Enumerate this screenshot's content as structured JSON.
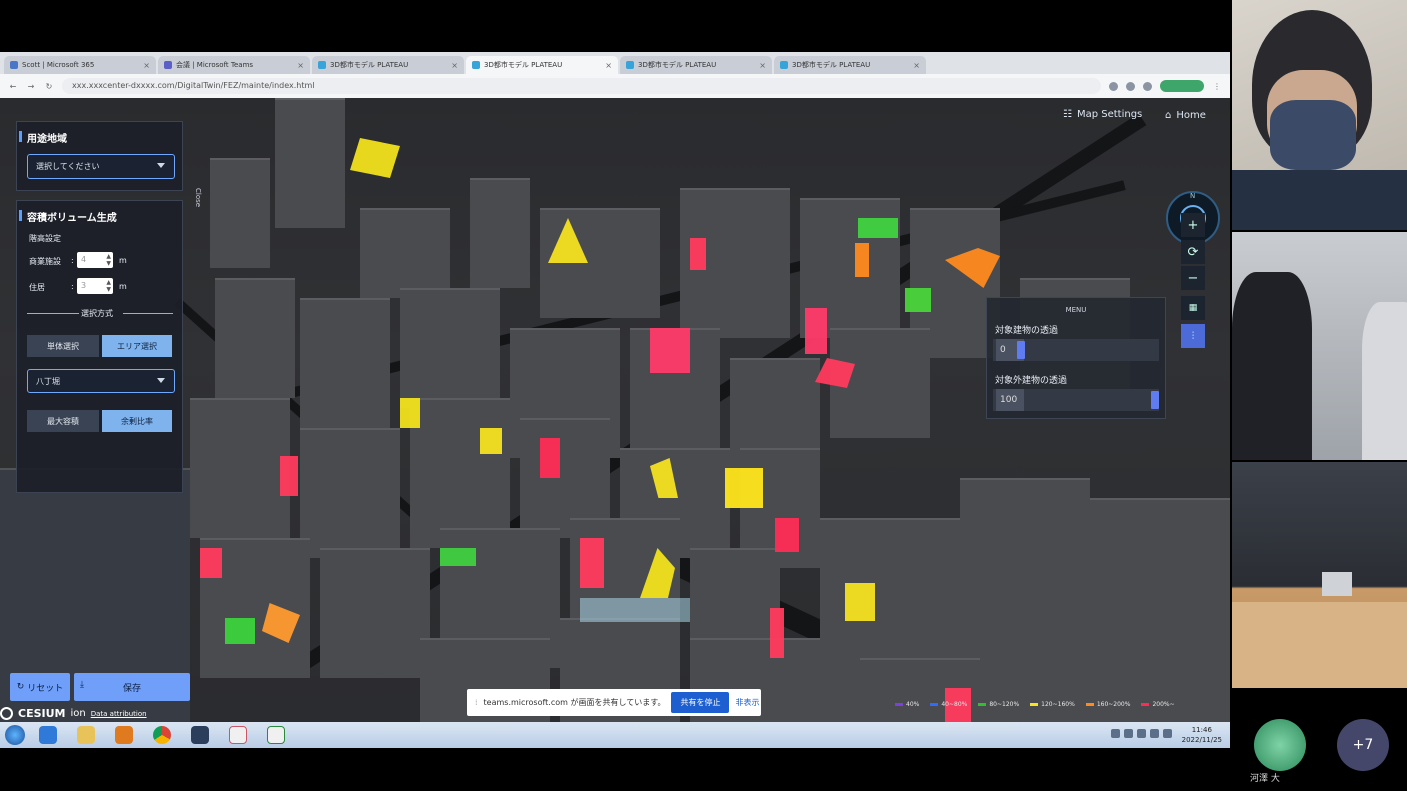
{
  "browser": {
    "tabs": [
      {
        "label": "Scott | Microsoft 365"
      },
      {
        "label": "会議 | Microsoft Teams"
      },
      {
        "label": "3D都市モデル PLATEAU"
      },
      {
        "label": "3D都市モデル PLATEAU"
      },
      {
        "label": "3D都市モデル PLATEAU"
      },
      {
        "label": "3D都市モデル PLATEAU"
      }
    ],
    "url": "xxx.xxxcenter-dxxxx.com/DigitalTwin/FEZ/mainte/index.html"
  },
  "left_panel": {
    "zoning": {
      "title": "用途地域",
      "select_value": "選択してください"
    },
    "volume": {
      "title": "容積ボリューム生成",
      "floor_heading": "階高設定",
      "commercial_label": "商業施設",
      "commercial_value": "4",
      "residential_label": "住居",
      "residential_value": "3",
      "unit": "m",
      "colon": ":",
      "selection_heading": "選択方式",
      "single_select": "単体選択",
      "area_select": "エリア選択",
      "area_value": "八丁堀",
      "max_volume": "最大容積",
      "surplus_ratio": "余剰比率"
    },
    "reset_label": "リセット",
    "save_label": "保存",
    "close_label": "Close"
  },
  "top_controls": {
    "map_settings": "Map Settings",
    "home": "Home",
    "compass_n": "N"
  },
  "menu_panel": {
    "title": "MENU",
    "target_label": "対象建物の透過",
    "target_value": "0",
    "nontarget_label": "対象外建物の透過",
    "nontarget_value": "100"
  },
  "legend": [
    {
      "label": "40%",
      "color": "#7b3fe4"
    },
    {
      "label": "40~80%",
      "color": "#2f6bff"
    },
    {
      "label": "80~120%",
      "color": "#2fbf2f"
    },
    {
      "label": "120~160%",
      "color": "#f5e61e"
    },
    {
      "label": "160~200%",
      "color": "#ff8a1e"
    },
    {
      "label": "200%~",
      "color": "#ff2b55"
    }
  ],
  "cesium": {
    "brand": "CESIUM",
    "suffix": "ion",
    "attribution": "Data attribution"
  },
  "share_banner": {
    "message": "teams.microsoft.com が画面を共有しています。",
    "stop_label": "共有を停止",
    "hide_label": "非表示"
  },
  "taskbar": {
    "time": "11:46",
    "date": "2022/11/25"
  },
  "teams": {
    "participant_name": "河澤 大",
    "more_count": "+7"
  }
}
